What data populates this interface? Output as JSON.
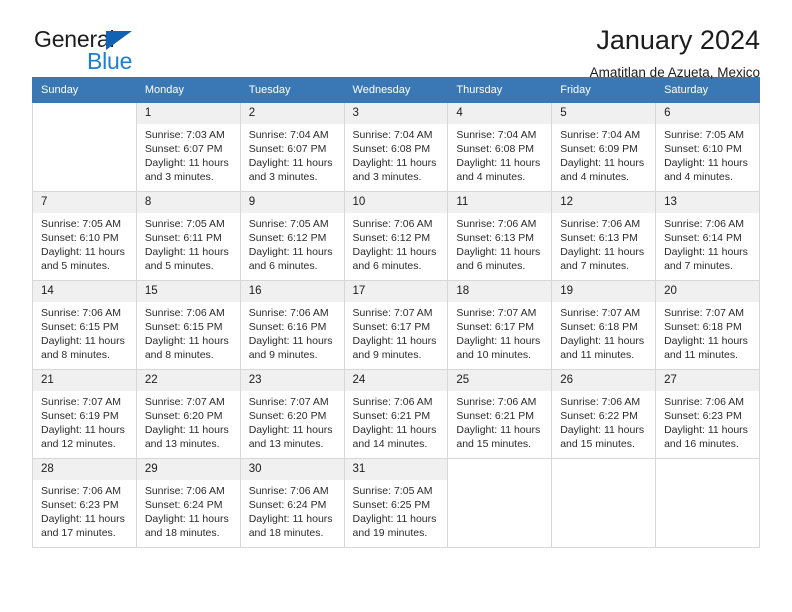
{
  "brand": {
    "name_top": "General",
    "name_bottom": "Blue",
    "accent_color": "#1b7fd4",
    "triangle_color": "#1262b3"
  },
  "header": {
    "title": "January 2024",
    "subtitle": "Amatitlan de Azueta, Mexico"
  },
  "calendar": {
    "header_bg": "#3a78b5",
    "daynum_bg": "#f0f0f0",
    "weekdays": [
      "Sunday",
      "Monday",
      "Tuesday",
      "Wednesday",
      "Thursday",
      "Friday",
      "Saturday"
    ],
    "labels": {
      "sunrise": "Sunrise:",
      "sunset": "Sunset:",
      "daylight": "Daylight:"
    },
    "weeks": [
      [
        {
          "day": "",
          "sunrise": "",
          "sunset": "",
          "daylight": ""
        },
        {
          "day": "1",
          "sunrise": "Sunrise: 7:03 AM",
          "sunset": "Sunset: 6:07 PM",
          "daylight": "Daylight: 11 hours and 3 minutes."
        },
        {
          "day": "2",
          "sunrise": "Sunrise: 7:04 AM",
          "sunset": "Sunset: 6:07 PM",
          "daylight": "Daylight: 11 hours and 3 minutes."
        },
        {
          "day": "3",
          "sunrise": "Sunrise: 7:04 AM",
          "sunset": "Sunset: 6:08 PM",
          "daylight": "Daylight: 11 hours and 3 minutes."
        },
        {
          "day": "4",
          "sunrise": "Sunrise: 7:04 AM",
          "sunset": "Sunset: 6:08 PM",
          "daylight": "Daylight: 11 hours and 4 minutes."
        },
        {
          "day": "5",
          "sunrise": "Sunrise: 7:04 AM",
          "sunset": "Sunset: 6:09 PM",
          "daylight": "Daylight: 11 hours and 4 minutes."
        },
        {
          "day": "6",
          "sunrise": "Sunrise: 7:05 AM",
          "sunset": "Sunset: 6:10 PM",
          "daylight": "Daylight: 11 hours and 4 minutes."
        }
      ],
      [
        {
          "day": "7",
          "sunrise": "Sunrise: 7:05 AM",
          "sunset": "Sunset: 6:10 PM",
          "daylight": "Daylight: 11 hours and 5 minutes."
        },
        {
          "day": "8",
          "sunrise": "Sunrise: 7:05 AM",
          "sunset": "Sunset: 6:11 PM",
          "daylight": "Daylight: 11 hours and 5 minutes."
        },
        {
          "day": "9",
          "sunrise": "Sunrise: 7:05 AM",
          "sunset": "Sunset: 6:12 PM",
          "daylight": "Daylight: 11 hours and 6 minutes."
        },
        {
          "day": "10",
          "sunrise": "Sunrise: 7:06 AM",
          "sunset": "Sunset: 6:12 PM",
          "daylight": "Daylight: 11 hours and 6 minutes."
        },
        {
          "day": "11",
          "sunrise": "Sunrise: 7:06 AM",
          "sunset": "Sunset: 6:13 PM",
          "daylight": "Daylight: 11 hours and 6 minutes."
        },
        {
          "day": "12",
          "sunrise": "Sunrise: 7:06 AM",
          "sunset": "Sunset: 6:13 PM",
          "daylight": "Daylight: 11 hours and 7 minutes."
        },
        {
          "day": "13",
          "sunrise": "Sunrise: 7:06 AM",
          "sunset": "Sunset: 6:14 PM",
          "daylight": "Daylight: 11 hours and 7 minutes."
        }
      ],
      [
        {
          "day": "14",
          "sunrise": "Sunrise: 7:06 AM",
          "sunset": "Sunset: 6:15 PM",
          "daylight": "Daylight: 11 hours and 8 minutes."
        },
        {
          "day": "15",
          "sunrise": "Sunrise: 7:06 AM",
          "sunset": "Sunset: 6:15 PM",
          "daylight": "Daylight: 11 hours and 8 minutes."
        },
        {
          "day": "16",
          "sunrise": "Sunrise: 7:06 AM",
          "sunset": "Sunset: 6:16 PM",
          "daylight": "Daylight: 11 hours and 9 minutes."
        },
        {
          "day": "17",
          "sunrise": "Sunrise: 7:07 AM",
          "sunset": "Sunset: 6:17 PM",
          "daylight": "Daylight: 11 hours and 9 minutes."
        },
        {
          "day": "18",
          "sunrise": "Sunrise: 7:07 AM",
          "sunset": "Sunset: 6:17 PM",
          "daylight": "Daylight: 11 hours and 10 minutes."
        },
        {
          "day": "19",
          "sunrise": "Sunrise: 7:07 AM",
          "sunset": "Sunset: 6:18 PM",
          "daylight": "Daylight: 11 hours and 11 minutes."
        },
        {
          "day": "20",
          "sunrise": "Sunrise: 7:07 AM",
          "sunset": "Sunset: 6:18 PM",
          "daylight": "Daylight: 11 hours and 11 minutes."
        }
      ],
      [
        {
          "day": "21",
          "sunrise": "Sunrise: 7:07 AM",
          "sunset": "Sunset: 6:19 PM",
          "daylight": "Daylight: 11 hours and 12 minutes."
        },
        {
          "day": "22",
          "sunrise": "Sunrise: 7:07 AM",
          "sunset": "Sunset: 6:20 PM",
          "daylight": "Daylight: 11 hours and 13 minutes."
        },
        {
          "day": "23",
          "sunrise": "Sunrise: 7:07 AM",
          "sunset": "Sunset: 6:20 PM",
          "daylight": "Daylight: 11 hours and 13 minutes."
        },
        {
          "day": "24",
          "sunrise": "Sunrise: 7:06 AM",
          "sunset": "Sunset: 6:21 PM",
          "daylight": "Daylight: 11 hours and 14 minutes."
        },
        {
          "day": "25",
          "sunrise": "Sunrise: 7:06 AM",
          "sunset": "Sunset: 6:21 PM",
          "daylight": "Daylight: 11 hours and 15 minutes."
        },
        {
          "day": "26",
          "sunrise": "Sunrise: 7:06 AM",
          "sunset": "Sunset: 6:22 PM",
          "daylight": "Daylight: 11 hours and 15 minutes."
        },
        {
          "day": "27",
          "sunrise": "Sunrise: 7:06 AM",
          "sunset": "Sunset: 6:23 PM",
          "daylight": "Daylight: 11 hours and 16 minutes."
        }
      ],
      [
        {
          "day": "28",
          "sunrise": "Sunrise: 7:06 AM",
          "sunset": "Sunset: 6:23 PM",
          "daylight": "Daylight: 11 hours and 17 minutes."
        },
        {
          "day": "29",
          "sunrise": "Sunrise: 7:06 AM",
          "sunset": "Sunset: 6:24 PM",
          "daylight": "Daylight: 11 hours and 18 minutes."
        },
        {
          "day": "30",
          "sunrise": "Sunrise: 7:06 AM",
          "sunset": "Sunset: 6:24 PM",
          "daylight": "Daylight: 11 hours and 18 minutes."
        },
        {
          "day": "31",
          "sunrise": "Sunrise: 7:05 AM",
          "sunset": "Sunset: 6:25 PM",
          "daylight": "Daylight: 11 hours and 19 minutes."
        },
        {
          "day": "",
          "sunrise": "",
          "sunset": "",
          "daylight": ""
        },
        {
          "day": "",
          "sunrise": "",
          "sunset": "",
          "daylight": ""
        },
        {
          "day": "",
          "sunrise": "",
          "sunset": "",
          "daylight": ""
        }
      ]
    ]
  }
}
